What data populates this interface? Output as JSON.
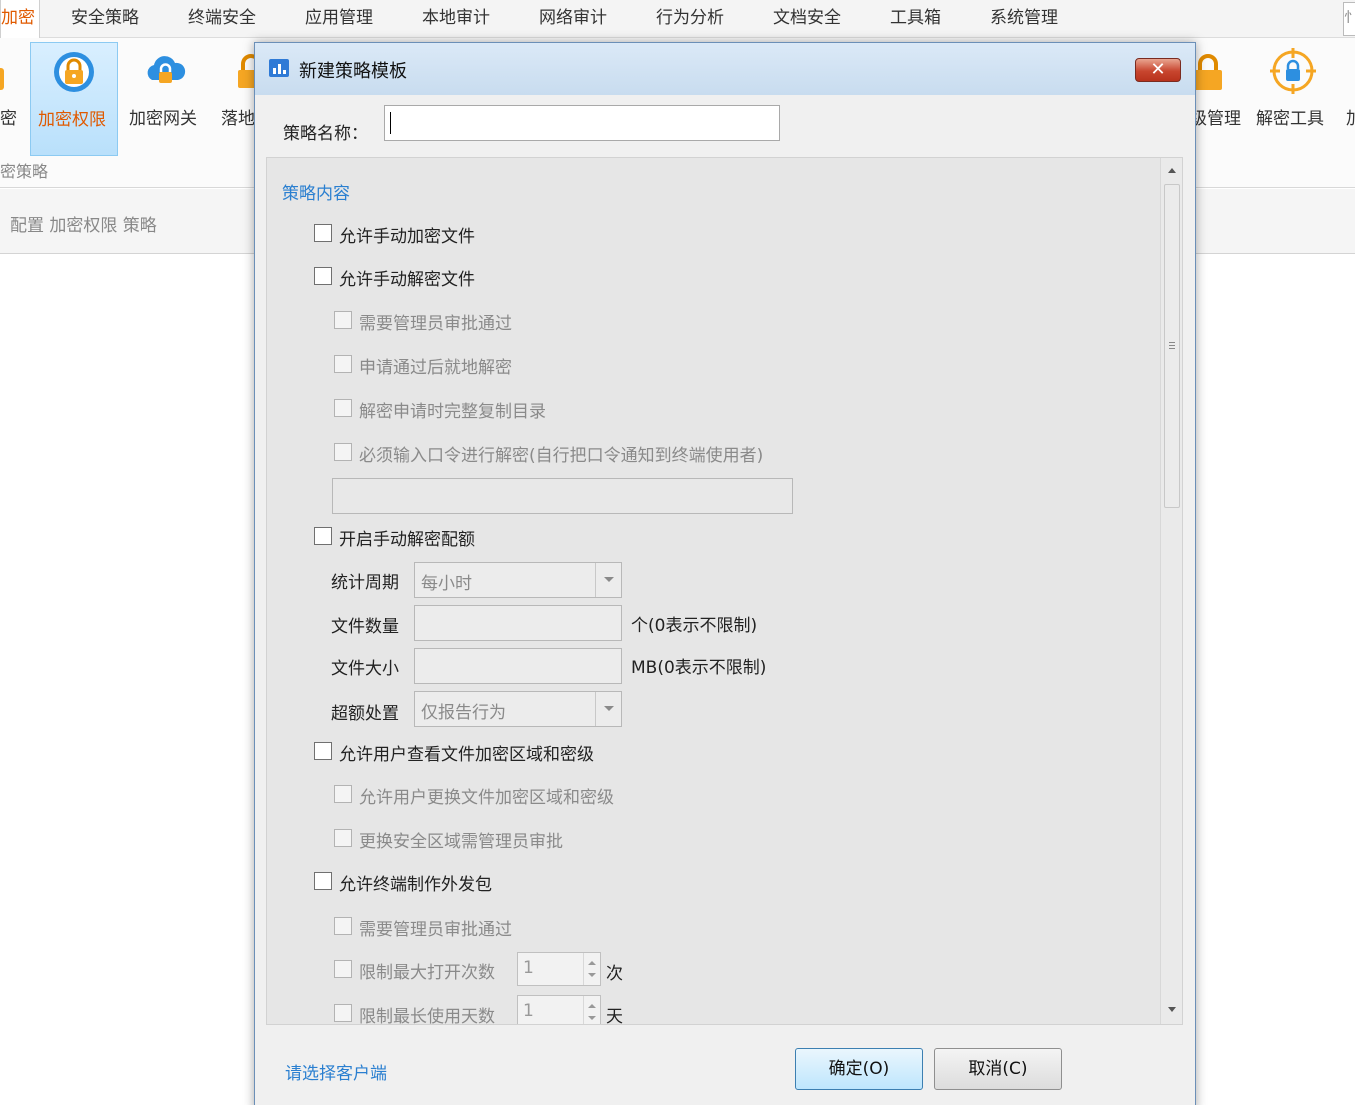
{
  "topmenu": {
    "items": [
      "加密",
      "安全策略",
      "终端安全",
      "应用管理",
      "本地审计",
      "网络审计",
      "行为分析",
      "文档安全",
      "工具箱",
      "系统管理"
    ],
    "edge_glyph": "忄"
  },
  "ribbon": {
    "left_partial_label": "密",
    "buttons": [
      "加密权限",
      "加密网关",
      "落地"
    ],
    "right_buttons": [
      "级管理",
      "解密工具",
      "加"
    ],
    "group_label": "密策略"
  },
  "breadcrumb": "配置 加密权限 策略",
  "dialog": {
    "title": "新建策略模板",
    "close_glyph": "✕",
    "name_label": "策略名称：",
    "name_value": "",
    "section_title": "策略内容",
    "checkboxes": [
      {
        "label": "允许手动加密文件",
        "checked": false,
        "enabled": true
      },
      {
        "label": "允许手动解密文件",
        "checked": false,
        "enabled": true
      },
      {
        "label": "需要管理员审批通过",
        "checked": false,
        "enabled": false
      },
      {
        "label": "申请通过后就地解密",
        "checked": false,
        "enabled": false
      },
      {
        "label": "解密申请时完整复制目录",
        "checked": false,
        "enabled": false
      },
      {
        "label": "必须输入口令进行解密(自行把口令通知到终端使用者)",
        "checked": false,
        "enabled": false
      },
      {
        "label": "开启手动解密配额",
        "checked": false,
        "enabled": true
      },
      {
        "label": "允许用户查看文件加密区域和密级",
        "checked": false,
        "enabled": true
      },
      {
        "label": "允许用户更换文件加密区域和密级",
        "checked": false,
        "enabled": false
      },
      {
        "label": "更换安全区域需管理员审批",
        "checked": false,
        "enabled": false
      },
      {
        "label": "允许终端制作外发包",
        "checked": false,
        "enabled": true
      },
      {
        "label": "需要管理员审批通过",
        "checked": false,
        "enabled": false
      },
      {
        "label": "限制最大打开次数",
        "checked": false,
        "enabled": false
      },
      {
        "label": "限制最长使用天数",
        "checked": false,
        "enabled": false
      }
    ],
    "quota": {
      "period_label": "统计周期",
      "period_value": "每小时",
      "count_label": "文件数量",
      "count_value": "",
      "count_hint": "个(0表示不限制)",
      "size_label": "文件大小",
      "size_value": "",
      "size_hint": "MB(0表示不限制)",
      "over_label": "超额处置",
      "over_value": "仅报告行为"
    },
    "max_open": {
      "value": "1",
      "unit": "次"
    },
    "max_days": {
      "value": "1",
      "unit": "天"
    },
    "select_client_link": "请选择客户端",
    "ok_label": "确定(O)",
    "cancel_label": "取消(C)"
  }
}
